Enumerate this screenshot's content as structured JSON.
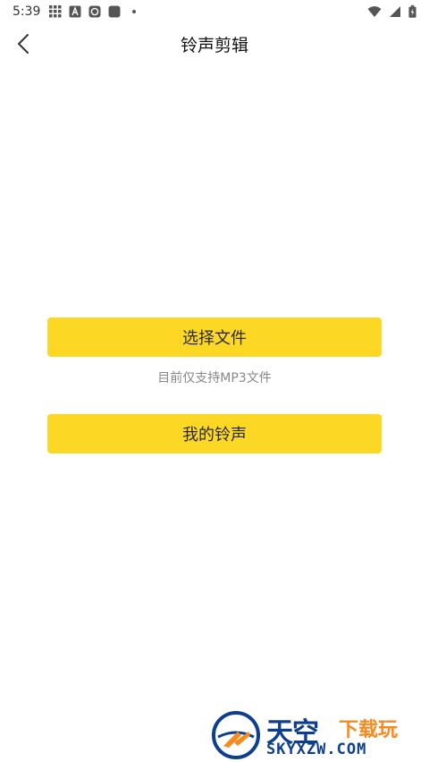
{
  "status_bar": {
    "time": "5:39",
    "left_icons": [
      "grid-icon",
      "a-icon",
      "app-icon",
      "square-icon",
      "dot-icon"
    ],
    "right_icons": [
      "wifi-icon",
      "signal-icon",
      "battery-icon"
    ]
  },
  "header": {
    "title": "铃声剪辑",
    "back_icon": "chevron-left-icon"
  },
  "actions": {
    "select_file_label": "选择文件",
    "hint_text": "目前仅支持MP3文件",
    "my_ringtones_label": "我的铃声"
  },
  "colors": {
    "accent": "#FCD825",
    "hint": "#888888",
    "watermark_blue": "#0d3f8c",
    "watermark_orange": "#f58a1f"
  },
  "watermark": {
    "title": "天空",
    "subtitle": "下载玩",
    "domain": "SKYXZW.COM"
  }
}
